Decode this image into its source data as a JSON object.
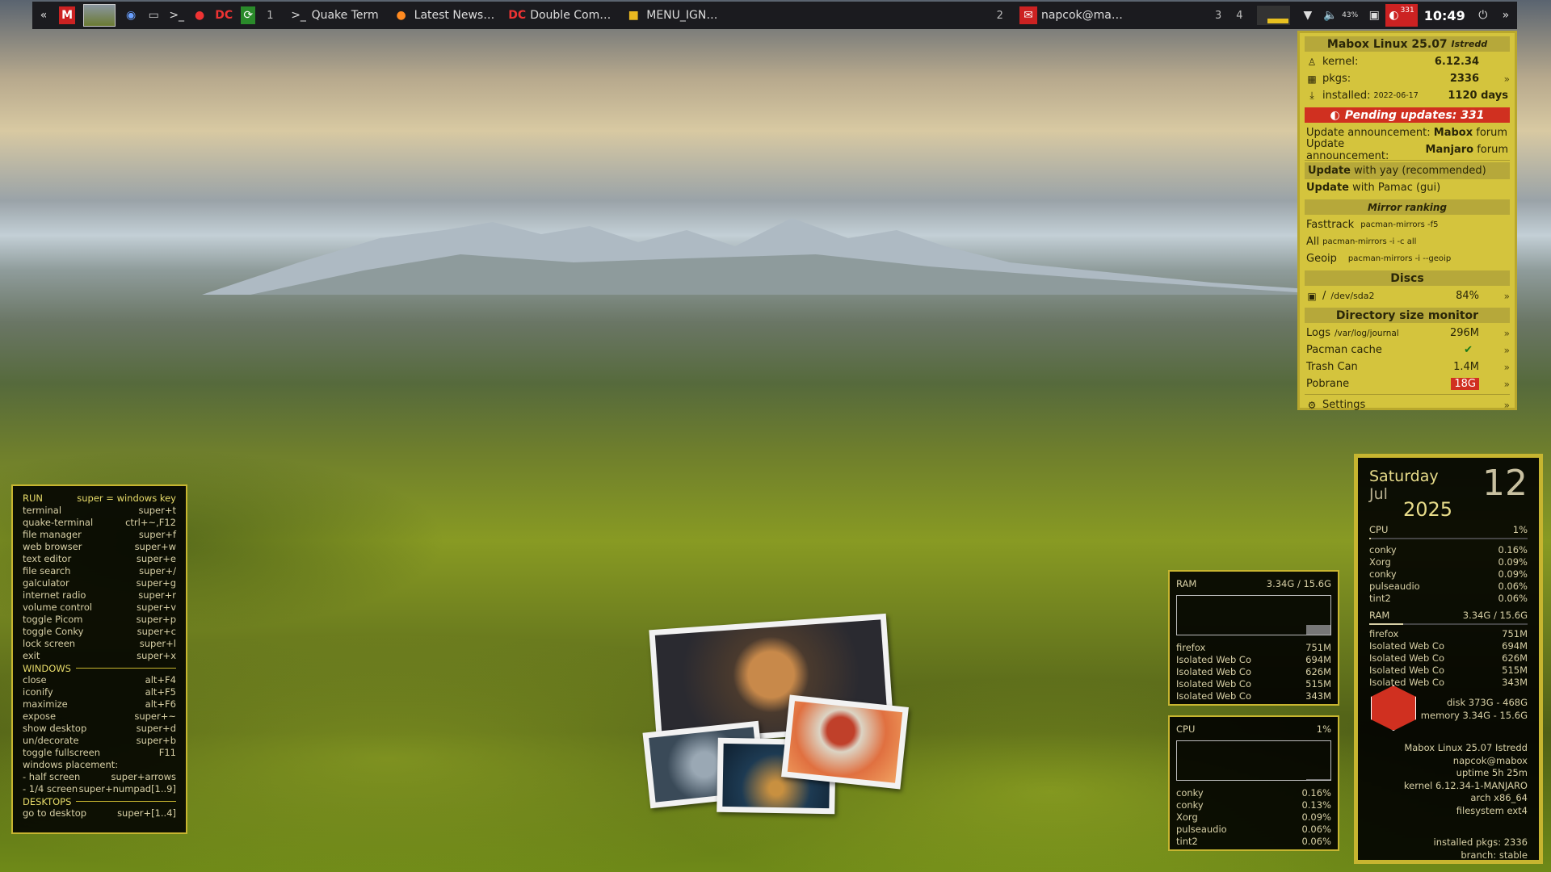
{
  "taskbar": {
    "workspace_1": "1",
    "workspace_2": "2",
    "workspace_3": "3",
    "workspace_4": "4",
    "tasks": [
      "Quake Term",
      "Latest News…",
      "Double Com…",
      "MENU_IGN…",
      "napcok@ma…"
    ],
    "volume": "43%",
    "updates_badge": "331",
    "clock": "10:49"
  },
  "mabox_panel": {
    "title": "Mabox Linux 25.07",
    "title_codename": "Istredd",
    "kernel_label": "kernel:",
    "kernel_value": "6.12.34",
    "pkgs_label": "pkgs:",
    "pkgs_value": "2336",
    "installed_label": "installed:",
    "installed_date": "2022-06-17",
    "installed_days": "1120 days",
    "pending": "Pending updates: 331",
    "announce1_prefix": "Update announcement:",
    "announce1_bold": "Mabox",
    "announce1_suffix": "forum",
    "announce2_prefix": "Update announcement:",
    "announce2_bold": "Manjaro",
    "announce2_suffix": "forum",
    "update_yay_bold": "Update",
    "update_yay_rest": "with yay (recommended)",
    "update_pamac_bold": "Update",
    "update_pamac_rest": "with Pamac (gui)",
    "mirror_header": "Mirror ranking",
    "mirrors": [
      {
        "label": "Fasttrack",
        "cmd": "pacman-mirrors -f5"
      },
      {
        "label": "All",
        "cmd": "pacman-mirrors -i -c all"
      },
      {
        "label": "Geoip",
        "cmd": "pacman-mirrors -i --geoip"
      }
    ],
    "discs_header": "Discs",
    "disc_mount": "/",
    "disc_dev": "/dev/sda2",
    "disc_usage": "84%",
    "dirsize_header": "Directory size monitor",
    "logs_label": "Logs",
    "logs_path": "/var/log/journal",
    "logs_size": "296M",
    "pacman_label": "Pacman cache",
    "trash_label": "Trash Can",
    "trash_size": "1.4M",
    "pobrane_label": "Pobrane",
    "pobrane_size": "18G",
    "settings_label": "Settings"
  },
  "keys_conky": {
    "run": "RUN",
    "run_note": "super = windows key",
    "run_items": [
      [
        "terminal",
        "super+t"
      ],
      [
        "quake-terminal",
        "ctrl+~,F12"
      ],
      [
        "file manager",
        "super+f"
      ],
      [
        "web browser",
        "super+w"
      ],
      [
        "text editor",
        "super+e"
      ],
      [
        "file search",
        "super+/"
      ],
      [
        "galculator",
        "super+g"
      ],
      [
        "internet radio",
        "super+r"
      ],
      [
        "volume control",
        "super+v"
      ],
      [
        "toggle Picom",
        "super+p"
      ],
      [
        "toggle Conky",
        "super+c"
      ],
      [
        "lock screen",
        "super+l"
      ],
      [
        "exit",
        "super+x"
      ]
    ],
    "windows": "WINDOWS",
    "window_items": [
      [
        "close",
        "alt+F4"
      ],
      [
        "iconify",
        "alt+F5"
      ],
      [
        "maximize",
        "alt+F6"
      ],
      [
        "expose",
        "super+~"
      ],
      [
        "show desktop",
        "super+d"
      ],
      [
        "un/decorate",
        "super+b"
      ],
      [
        "toggle fullscreen",
        "F11"
      ],
      [
        "windows placement:",
        ""
      ],
      [
        " - half screen",
        "super+arrows"
      ],
      [
        " - 1/4 screen",
        "super+numpad[1..9]"
      ]
    ],
    "desktops": "DESKTOPS",
    "desktop_items": [
      [
        "go to desktop",
        "super+[1..4]"
      ]
    ]
  },
  "ram_conky": {
    "label": "RAM",
    "usage": "3.34G / 15.6G",
    "procs": [
      [
        "firefox",
        "751M"
      ],
      [
        "Isolated Web Co",
        "694M"
      ],
      [
        "Isolated Web Co",
        "626M"
      ],
      [
        "Isolated Web Co",
        "515M"
      ],
      [
        "Isolated Web Co",
        "343M"
      ]
    ]
  },
  "cpu_conky": {
    "label": "CPU",
    "usage": "1%",
    "procs": [
      [
        "conky",
        "0.16%"
      ],
      [
        "conky",
        "0.13%"
      ],
      [
        "Xorg",
        "0.09%"
      ],
      [
        "pulseaudio",
        "0.06%"
      ],
      [
        "tint2",
        "0.06%"
      ]
    ]
  },
  "sysinfo_conky": {
    "weekday": "Saturday",
    "month": "Jul",
    "day": "12",
    "year": "2025",
    "cpu_label": "CPU",
    "cpu_usage": "1%",
    "cpu_procs": [
      [
        "conky",
        "0.16%"
      ],
      [
        "Xorg",
        "0.09%"
      ],
      [
        "conky",
        "0.09%"
      ],
      [
        "pulseaudio",
        "0.06%"
      ],
      [
        "tint2",
        "0.06%"
      ]
    ],
    "ram_label": "RAM",
    "ram_usage": "3.34G / 15.6G",
    "ram_procs": [
      [
        "firefox",
        "751M"
      ],
      [
        "Isolated Web Co",
        "694M"
      ],
      [
        "Isolated Web Co",
        "626M"
      ],
      [
        "Isolated Web Co",
        "515M"
      ],
      [
        "Isolated Web Co",
        "343M"
      ]
    ],
    "disk": "disk 373G - 468G",
    "memory": "memory 3.34G - 15.6G",
    "distro": "Mabox Linux 25.07 Istredd",
    "user": "napcok@mabox",
    "uptime": "uptime 5h 25m",
    "kernel": "kernel 6.12.34-1-MANJARO",
    "arch": "arch x86_64",
    "filesystem": "filesystem ext4",
    "installed_pkgs": "installed pkgs: 2336",
    "branch": "branch: stable"
  },
  "levels": {
    "ram_fraction": 0.214,
    "cpu_fraction": 0.01,
    "disk_fraction": 0.84
  },
  "colors": {
    "accent_yellow": "#c7b530",
    "panel_yellow": "#d4c43d",
    "alert_red": "#d03020"
  }
}
